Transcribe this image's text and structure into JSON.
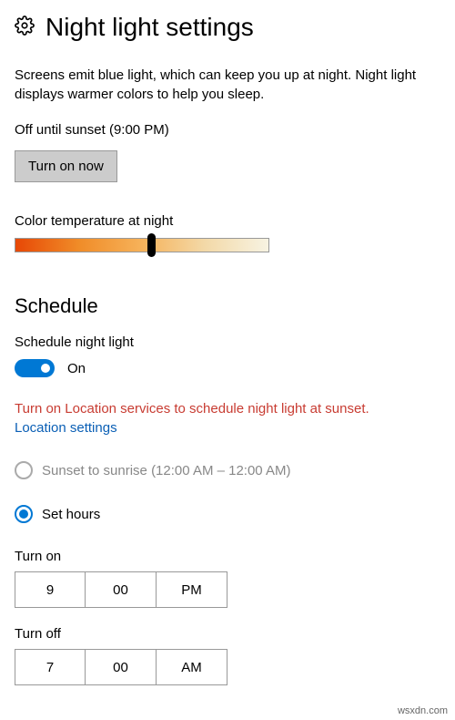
{
  "header": {
    "title": "Night light settings"
  },
  "description": "Screens emit blue light, which can keep you up at night. Night light displays warmer colors to help you sleep.",
  "status": "Off until sunset (9:00 PM)",
  "turn_on_button": "Turn on now",
  "color_temp_label": "Color temperature at night",
  "schedule": {
    "heading": "Schedule",
    "label": "Schedule night light",
    "toggle_state": "On",
    "warning": "Turn on Location services to schedule night light at sunset.",
    "link": "Location settings",
    "option_sunset": "Sunset to sunrise (12:00 AM – 12:00 AM)",
    "option_set_hours": "Set hours"
  },
  "turn_on": {
    "label": "Turn on",
    "hour": "9",
    "minute": "00",
    "period": "PM"
  },
  "turn_off": {
    "label": "Turn off",
    "hour": "7",
    "minute": "00",
    "period": "AM"
  },
  "watermark": "wsxdn.com"
}
